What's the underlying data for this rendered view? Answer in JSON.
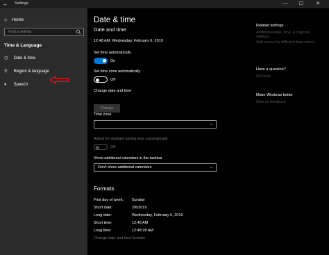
{
  "window": {
    "back_glyph": "←",
    "title": "Settings",
    "min_glyph": "—",
    "max_glyph": "☐",
    "close_glyph": "✕"
  },
  "sidebar": {
    "home": {
      "icon": "home-icon",
      "glyph": "⌂",
      "label": "Home"
    },
    "search_placeholder": "Find a setting",
    "section": "Time & Language",
    "items": [
      {
        "icon": "clock-icon",
        "glyph": "◷",
        "label": "Date & time"
      },
      {
        "icon": "globe-icon",
        "glyph": "⚲",
        "label": "Region & language"
      },
      {
        "icon": "mic-icon",
        "glyph": "♦",
        "label": "Speech"
      }
    ]
  },
  "main": {
    "page_title": "Date & time",
    "section_title": "Date and time",
    "current_datetime": "12:48 AM, Wednesday, February 6, 2019",
    "set_time_auto": {
      "label": "Set time automatically",
      "state": "On"
    },
    "set_tz_auto": {
      "label": "Set time zone automatically",
      "state": "Off"
    },
    "change_label": "Change date and time",
    "change_button": "Change",
    "time_zone_label": "Time zone",
    "time_zone_value": "",
    "dst_label": "Adjust for daylight saving time automatically",
    "dst_state": "Off",
    "calendars_label": "Show additional calendars in the taskbar",
    "calendars_value": "Don't show additional calendars",
    "formats_title": "Formats",
    "formats": [
      {
        "label": "First day of week:",
        "value": "Sunday"
      },
      {
        "label": "Short date:",
        "value": "2/6/2019"
      },
      {
        "label": "Long date:",
        "value": "Wednesday, February 6, 2019"
      },
      {
        "label": "Short time:",
        "value": "12:48 AM"
      },
      {
        "label": "Long time:",
        "value": "12:48:28 AM"
      }
    ],
    "formats_link": "Change date and time formats"
  },
  "related": {
    "heading": "Related settings",
    "links": [
      "Additional date, time, & regional",
      "settings",
      "Add clocks for different time zones"
    ],
    "question_heading": "Have a question?",
    "question_link": "Get help",
    "better_heading": "Make Windows better",
    "better_link": "Give us feedback"
  },
  "colors": {
    "accent": "#0078d7",
    "arrow": "#e0141e",
    "sidebar_bg": "#2b2b2b",
    "main_bg": "#000000"
  }
}
